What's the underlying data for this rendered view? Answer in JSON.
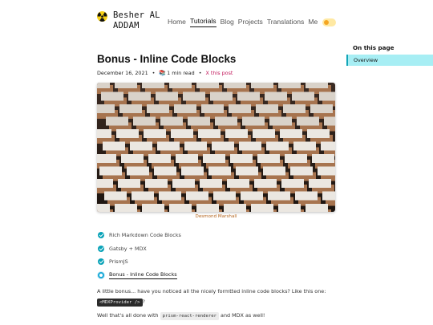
{
  "header": {
    "brand_line1": "Besher AL",
    "brand_line2": "ADDAM",
    "nav": [
      {
        "label": "Home",
        "active": false
      },
      {
        "label": "Tutorials",
        "active": true
      },
      {
        "label": "Blog",
        "active": false
      },
      {
        "label": "Projects",
        "active": false
      },
      {
        "label": "Translations",
        "active": false
      },
      {
        "label": "Me",
        "active": false
      }
    ],
    "theme_toggle_icon": "sun-icon"
  },
  "article": {
    "title": "Bonus - Inline Code Blocks",
    "date": "December 16, 2021",
    "read_time": "1 min read",
    "share_label": "X this post",
    "image_caption": "Desmond Marshall",
    "toc_items": [
      {
        "label": "Rich Markdown Code Blocks",
        "done": true
      },
      {
        "label": "Gatsby + MDX",
        "done": true
      },
      {
        "label": "PrismJS",
        "done": true
      },
      {
        "label": "Bonus - Inline Code Blocks",
        "done": false,
        "current": true
      }
    ],
    "para1_text": "A little bonus... have you noticed all the nicely formtted inline code blocks? Like this one:",
    "para1_code": "<MDXProvider />",
    "para1_end": "?",
    "para2_start": "Well that's all done with",
    "para2_code": "prism-react-renderer",
    "para2_end": "and MDX as well!"
  },
  "sidebar": {
    "heading": "On this page",
    "items": [
      {
        "label": "Overview",
        "active": true
      }
    ]
  },
  "colors": {
    "accent": "#13a6b8",
    "sidebar_active_bg": "#a7eef4",
    "share_link": "#c2185b",
    "caption": "#b5651d"
  }
}
